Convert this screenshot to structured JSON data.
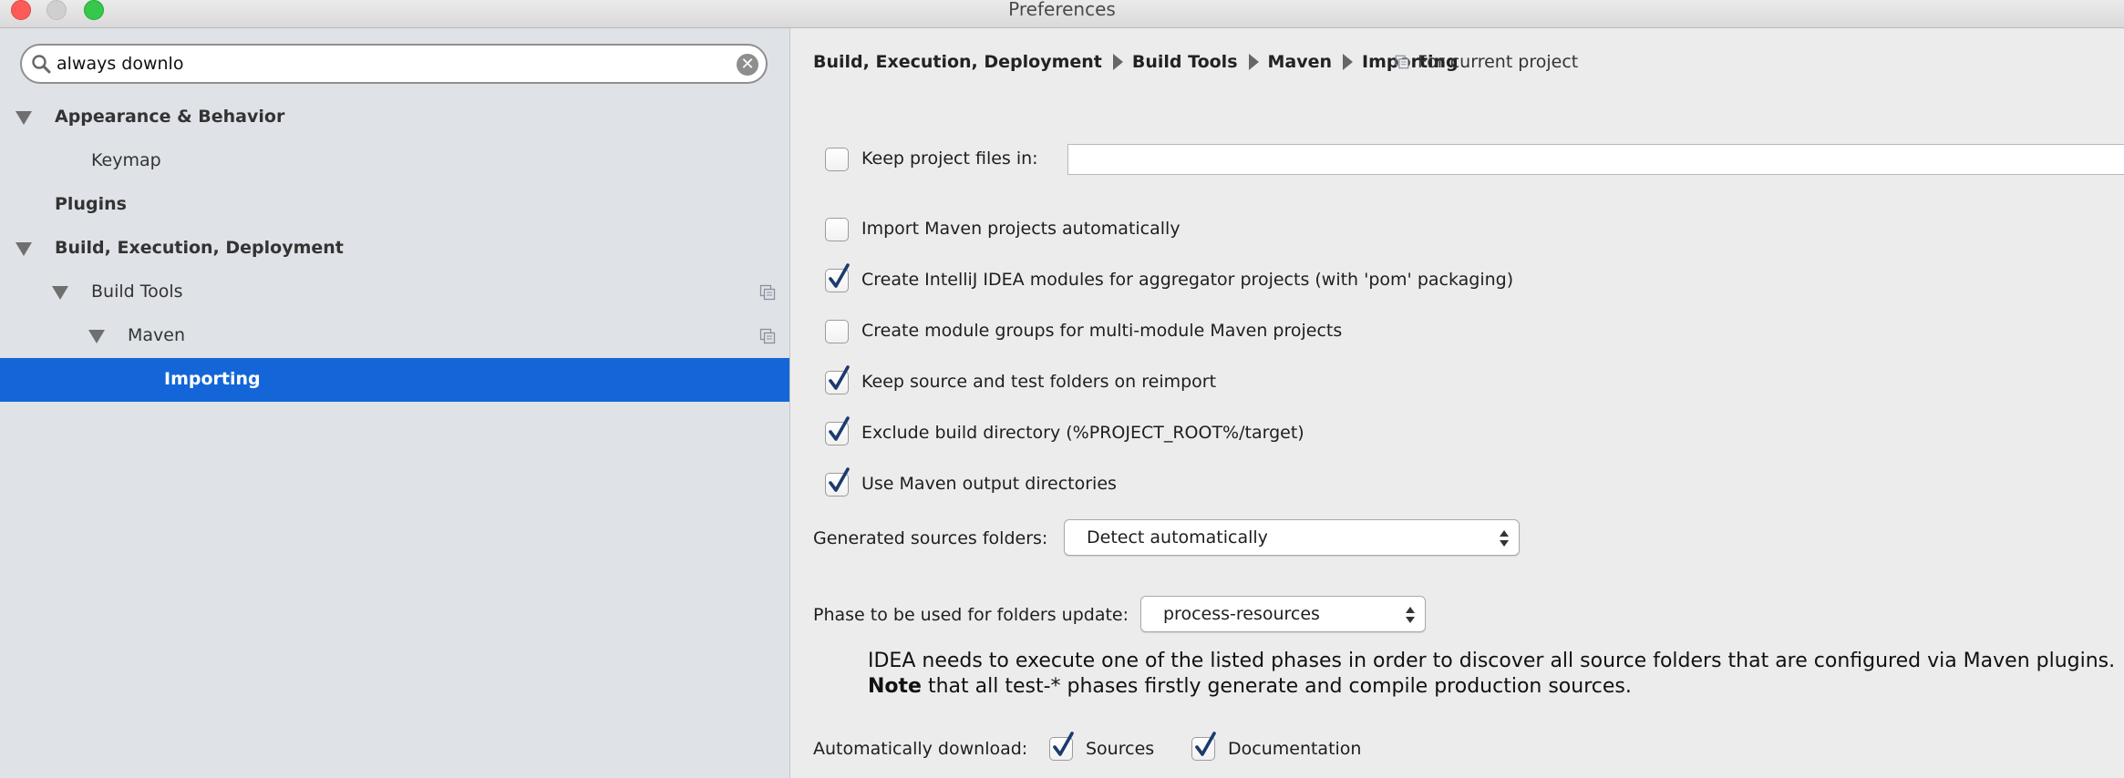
{
  "window": {
    "title": "Preferences"
  },
  "search": {
    "value": "always downlo"
  },
  "sidebar": {
    "items": [
      {
        "label": "Appearance & Behavior"
      },
      {
        "label": "Keymap"
      },
      {
        "label": "Plugins"
      },
      {
        "label": "Build, Execution, Deployment"
      },
      {
        "label": "Build Tools"
      },
      {
        "label": "Maven"
      },
      {
        "label": "Importing",
        "selected": true
      }
    ]
  },
  "breadcrumb": [
    "Build, Execution, Deployment",
    "Build Tools",
    "Maven",
    "Importing"
  ],
  "scope": {
    "label": "For current project"
  },
  "options": {
    "keep_project_files": {
      "label": "Keep project files in:",
      "checked": false,
      "value": ""
    },
    "import_auto": {
      "label": "Import Maven projects automatically",
      "checked": false
    },
    "create_modules": {
      "label": "Create IntelliJ IDEA modules for aggregator projects (with 'pom' packaging)",
      "checked": true
    },
    "module_groups": {
      "label": "Create module groups for multi-module Maven projects",
      "checked": false
    },
    "keep_source": {
      "label": "Keep source and test folders on reimport",
      "checked": true
    },
    "exclude_build": {
      "label": "Exclude build directory (%PROJECT_ROOT%/target)",
      "checked": true
    },
    "use_output": {
      "label": "Use Maven output directories",
      "checked": true
    }
  },
  "generated_sources": {
    "label": "Generated sources folders:",
    "value": "Detect automatically"
  },
  "phase": {
    "label": "Phase to be used for folders update:",
    "value": "process-resources"
  },
  "note": {
    "line1": "IDEA needs to execute one of the listed phases in order to discover all source folders that are configured via Maven plugins.",
    "line2_bold": "Note",
    "line2_rest": " that all test-* phases firstly generate and compile production sources."
  },
  "auto_download": {
    "label": "Automatically download:",
    "sources": {
      "label": "Sources",
      "checked": true
    },
    "documentation": {
      "label": "Documentation",
      "checked": true
    }
  },
  "colors": {
    "selection": "#1466d8",
    "sidebar_bg": "#dfe2e7",
    "panel_bg": "#ececec",
    "check": "#1c3a6e"
  }
}
